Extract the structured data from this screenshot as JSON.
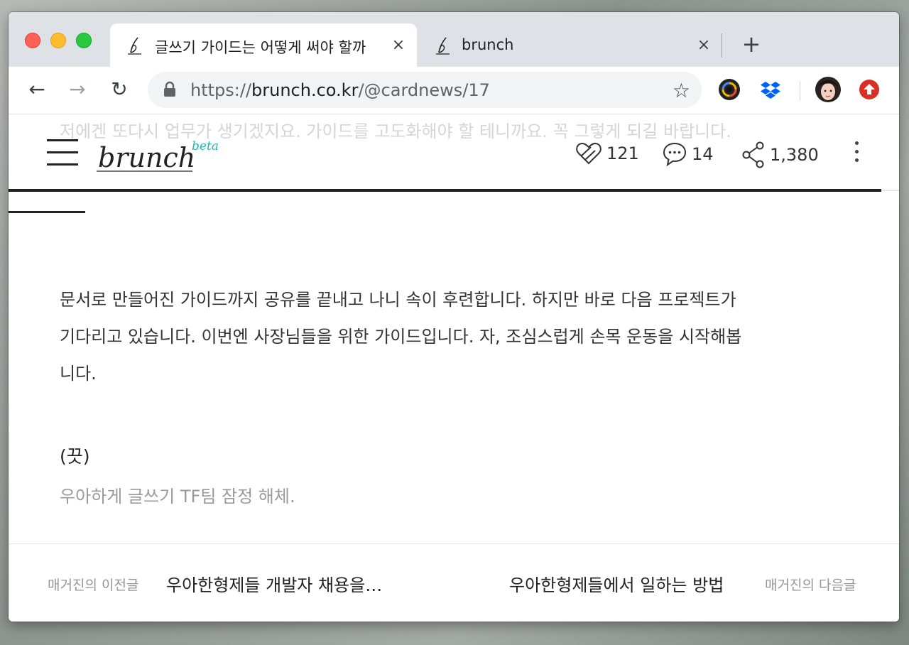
{
  "tabs": [
    {
      "title": "글쓰기 가이드는 어떻게 써야 할까",
      "active": true,
      "close_glyph": "×"
    },
    {
      "title": "brunch",
      "active": false,
      "close_glyph": "×"
    }
  ],
  "new_tab_glyph": "+",
  "toolbar": {
    "back_glyph": "←",
    "forward_glyph": "→",
    "reload_glyph": "↻",
    "star_glyph": "☆",
    "url_scheme": "https://",
    "url_host": "brunch.co.kr",
    "url_path": "/@cardnews/17"
  },
  "extensions": [
    "camera-extension-icon",
    "dropbox-icon",
    "profile-avatar",
    "upload-extension-icon"
  ],
  "article": {
    "ghost_line": "저에겐 또다시 업무가 생기겠지요. 가이드를 고도화해야 할 테니까요. 꼭 그렇게 되길 바랍니다.",
    "paragraph_lines": [
      "문서로 만들어진 가이드까지 공유를 끝내고 나니 속이 후련합니다. 하지만 바로 다음 프로젝트가",
      "기다리고 있습니다. 이번엔 사장님들을 위한 가이드입니다. 자, 조심스럽게 손목 운동을 시작해봅",
      "니다."
    ],
    "end_mark": "(끗)",
    "end_sub": "우아하게 글쓰기 TF팀 잠정 해체."
  },
  "site_header": {
    "logo_text": "brunch",
    "logo_badge": "beta",
    "likes": "121",
    "comments": "14",
    "shares": "1,380",
    "reading_progress": 0.98
  },
  "footer": {
    "prev_label": "매거진의 이전글",
    "prev_title": "우아한형제들 개발자 채용을…",
    "next_title": "우아한형제들에서 일하는 방법",
    "next_label": "매거진의 다음글"
  },
  "colors": {
    "accent_teal": "#1fb6b0",
    "tab_strip": "#dee1e6",
    "text_dark": "#333333",
    "text_muted": "#9a9a9a"
  }
}
